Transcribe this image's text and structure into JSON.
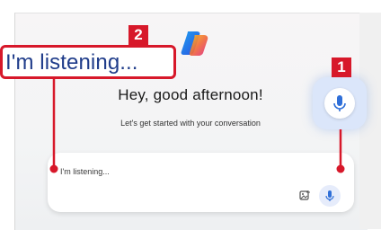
{
  "greeting": "Hey, good afternoon!",
  "subtitle": "Let's get started with your conversation",
  "chat": {
    "placeholder": "I'm listening..."
  },
  "callout": {
    "text": "I'm listening...",
    "badge_number": "2"
  },
  "mic_callout": {
    "badge_number": "1"
  },
  "colors": {
    "annotation_red": "#d7182a",
    "callout_text_blue": "#1f3c8a",
    "mic_blue": "#2f6fd8"
  },
  "icons": {
    "logo": "copilot-logo",
    "mic": "microphone-icon",
    "image": "image-upload-icon"
  }
}
